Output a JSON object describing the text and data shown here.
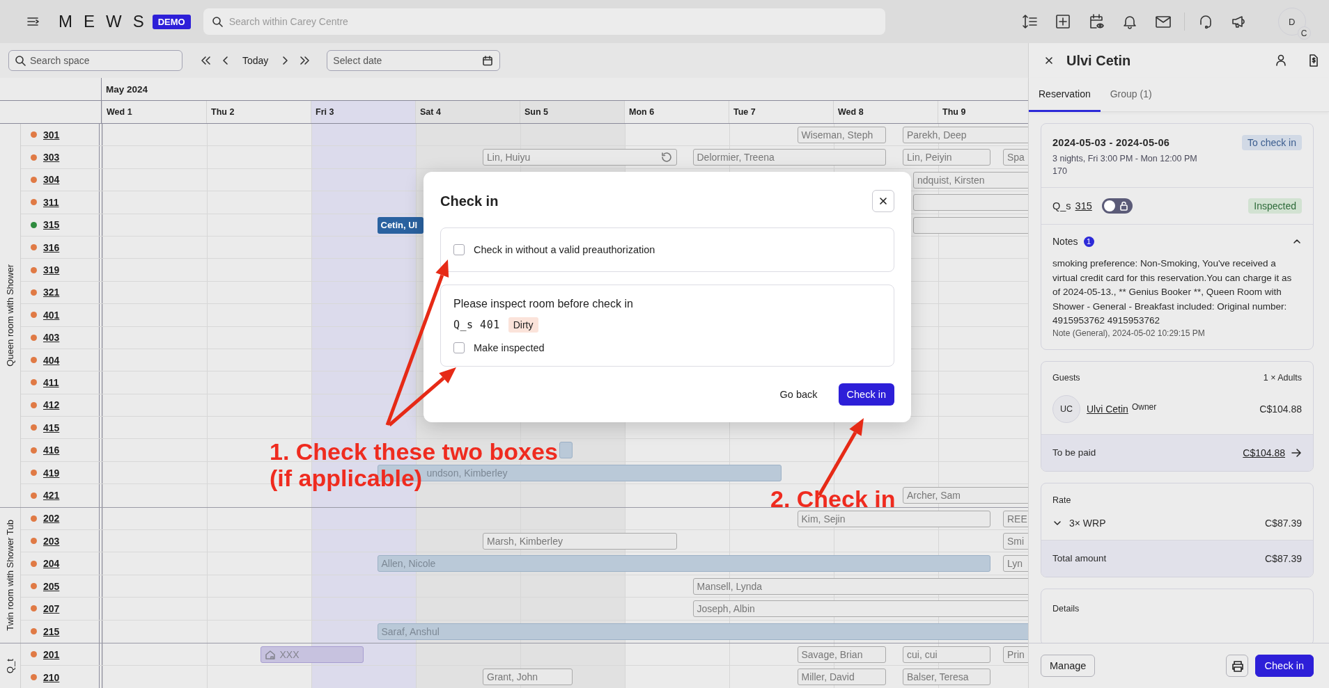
{
  "top_bar": {
    "logo": "MEWS",
    "environment": "DEMO",
    "search": {
      "placeholder": "Search within Carey Centre"
    },
    "avatar": {
      "initials": "D",
      "badge": "C"
    }
  },
  "toolbar": {
    "search": {
      "placeholder": "Search space"
    },
    "today": "Today",
    "date": {
      "placeholder": "Select date"
    }
  },
  "calendar": {
    "month": "May 2024",
    "days": [
      {
        "label": "Wed 1",
        "kind": "weekday"
      },
      {
        "label": "Thu 2",
        "kind": "weekday"
      },
      {
        "label": "Fri 3",
        "kind": "highlighted"
      },
      {
        "label": "Sat 4",
        "kind": "weekend"
      },
      {
        "label": "Sun 5",
        "kind": "weekend"
      },
      {
        "label": "Mon 6",
        "kind": "weekday"
      },
      {
        "label": "Tue 7",
        "kind": "weekday"
      },
      {
        "label": "Wed 8",
        "kind": "weekday"
      },
      {
        "label": "Thu 9",
        "kind": "weekday"
      }
    ],
    "groups": [
      {
        "name": "Queen room with Shower",
        "rooms": [
          {
            "number": "301",
            "color": "#e07a45",
            "bookings": [
              {
                "guest": "Wiseman, Steph",
                "kind": "outline"
              },
              {
                "guest": "Parekh, Deep",
                "kind": "outline"
              }
            ]
          },
          {
            "number": "303",
            "color": "#e07a45",
            "bookings": [
              {
                "guest": "Lin, Huiyu",
                "kind": "outline",
                "recurring": true
              },
              {
                "guest": "Delormier, Treena",
                "kind": "outline"
              },
              {
                "guest": "Lin, Peiyin",
                "kind": "outline"
              },
              {
                "guest": "Spa",
                "kind": "outline"
              }
            ]
          },
          {
            "number": "304",
            "color": "#e07a45",
            "bookings": [
              {
                "guest": "ndquist, Kirsten",
                "kind": "outline"
              }
            ]
          },
          {
            "number": "311",
            "color": "#e07a45",
            "bookings": [
              {
                "kind": "outline"
              }
            ]
          },
          {
            "number": "315",
            "color": "#2e8b3e",
            "bookings": [
              {
                "guest": "Cetin, Ul",
                "kind": "current"
              },
              {
                "kind": "outline"
              }
            ]
          },
          {
            "number": "316",
            "color": "#e07a45"
          },
          {
            "number": "319",
            "color": "#e07a45"
          },
          {
            "number": "321",
            "color": "#e07a45"
          },
          {
            "number": "401",
            "color": "#e07a45"
          },
          {
            "number": "403",
            "color": "#e07a45"
          },
          {
            "number": "404",
            "color": "#e07a45"
          },
          {
            "number": "411",
            "color": "#e07a45"
          },
          {
            "number": "412",
            "color": "#e07a45"
          },
          {
            "number": "415",
            "color": "#e07a45"
          },
          {
            "number": "416",
            "color": "#e07a45",
            "bookings": [
              {
                "kind": "filled"
              }
            ]
          },
          {
            "number": "419",
            "color": "#e07a45",
            "bookings": [
              {
                "guest": "undson, Kimberley",
                "kind": "filled"
              }
            ]
          },
          {
            "number": "421",
            "color": "#e07a45",
            "bookings": [
              {
                "guest": "Archer, Sam",
                "kind": "outline"
              }
            ]
          }
        ]
      },
      {
        "name": "Twin room with Shower Tub",
        "rooms": [
          {
            "number": "202",
            "color": "#e07a45",
            "bookings": [
              {
                "guest": "Kim, Sejin",
                "kind": "outline"
              },
              {
                "guest": "REE",
                "kind": "outline"
              }
            ]
          },
          {
            "number": "203",
            "color": "#e07a45",
            "bookings": [
              {
                "guest": "Marsh, Kimberley",
                "kind": "outline"
              },
              {
                "guest": "Smi",
                "kind": "outline"
              }
            ]
          },
          {
            "number": "204",
            "color": "#e07a45",
            "bookings": [
              {
                "guest": "Allen, Nicole",
                "kind": "filled"
              },
              {
                "guest": "Lyn",
                "kind": "outline"
              }
            ]
          },
          {
            "number": "205",
            "color": "#e07a45",
            "bookings": [
              {
                "guest": "Mansell, Lynda",
                "kind": "outline"
              }
            ]
          },
          {
            "number": "207",
            "color": "#e07a45",
            "bookings": [
              {
                "guest": "Joseph, Albin",
                "kind": "outline"
              }
            ]
          },
          {
            "number": "215",
            "color": "#e07a45",
            "bookings": [
              {
                "guest": "Saraf, Anshul",
                "kind": "filled"
              }
            ]
          }
        ]
      },
      {
        "name": "Q_t",
        "rooms": [
          {
            "number": "201",
            "color": "#e07a45",
            "bookings": [
              {
                "guest": "XXX",
                "kind": "blocked"
              },
              {
                "guest": "Savage, Brian",
                "kind": "outline"
              },
              {
                "guest": "cui, cui",
                "kind": "outline"
              },
              {
                "guest": "Prin",
                "kind": "outline"
              }
            ]
          },
          {
            "number": "210",
            "color": "#e07a45",
            "bookings": [
              {
                "guest": "Grant, John",
                "kind": "outline"
              },
              {
                "guest": "Miller, David",
                "kind": "outline"
              },
              {
                "guest": "Balser, Teresa",
                "kind": "outline"
              }
            ]
          }
        ]
      }
    ]
  },
  "dialog": {
    "title": "Check in",
    "options": [
      {
        "label": "Check in without a valid preauthorization",
        "checked": false
      }
    ],
    "inspection": {
      "heading": "Please inspect room before check in",
      "category": "Q_s",
      "room": "401",
      "state": "Dirty",
      "option": {
        "label": "Make inspected",
        "checked": false
      }
    },
    "buttons": [
      {
        "label": "Go back",
        "kind": "secondary"
      },
      {
        "label": "Check in",
        "kind": "primary"
      }
    ]
  },
  "panel": {
    "title": "Ulvi Cetin",
    "tabs": [
      {
        "label": "Reservation",
        "selected": true
      },
      {
        "label": "Group (1)",
        "selected": false
      }
    ],
    "stay": {
      "dates": "2024-05-03 - 2024-05-06",
      "status": "To check in",
      "summary": "3 nights, Fri 3:00 PM - Mon 12:00 PM",
      "number": "170"
    },
    "room": {
      "category": "Q_s",
      "number": "315",
      "lock": {
        "on": false
      },
      "state": "Inspected"
    },
    "notes": {
      "label": "Notes",
      "count": "1",
      "expanded": true,
      "text": "smoking preference: Non-Smoking, You've received a virtual credit card for this reservation.You can charge it as of 2024-05-13., ** Genius Booker **, Queen Room with Shower - General - Breakfast included: Original number: 4915953762 4915953762",
      "meta": "Note (General), 2024-05-02 10:29:15 PM"
    },
    "guests": {
      "label": "Guests",
      "count": "1 × Adults",
      "list": [
        {
          "initials": "UC",
          "name": "Ulvi Cetin",
          "role": "Owner",
          "amount": "C$104.88"
        }
      ],
      "to_be_paid": {
        "label": "To be paid",
        "amount": "C$104.88"
      }
    },
    "rate": {
      "label": "Rate",
      "items": [
        {
          "label": "3× WRP",
          "amount": "C$87.39",
          "expanded": false
        }
      ],
      "total": {
        "label": "Total amount",
        "amount": "C$87.39"
      }
    },
    "details": {
      "label": "Details"
    },
    "actions": {
      "manage": "Manage",
      "check_in": "Check in"
    }
  },
  "annotations": [
    {
      "text": "1. Check these two boxes"
    },
    {
      "text": "(if applicable)"
    },
    {
      "text": "2. Check in"
    }
  ]
}
